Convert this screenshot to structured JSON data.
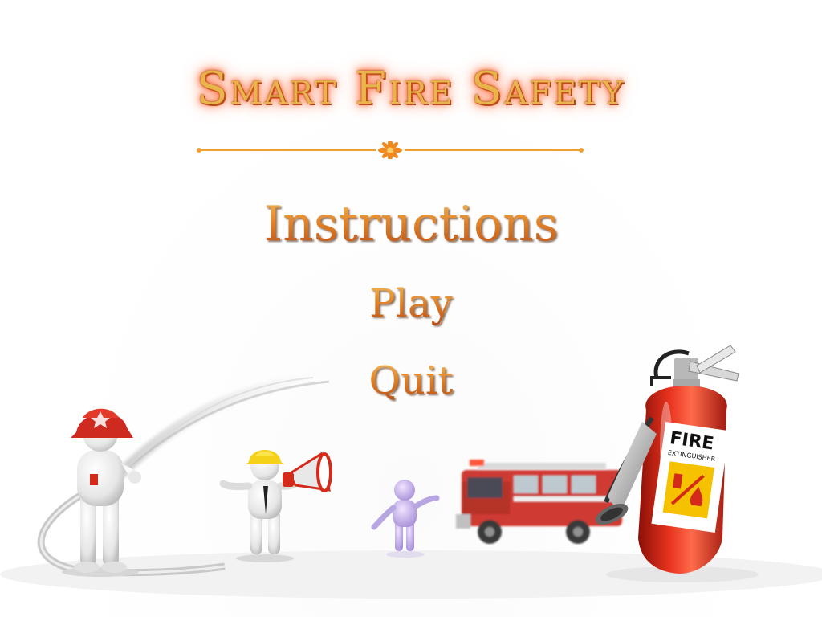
{
  "game": {
    "title": "Smart Fire Safety",
    "menu": [
      {
        "label": "Instructions"
      },
      {
        "label": "Play"
      },
      {
        "label": "Quit"
      }
    ]
  },
  "decor": {
    "extinguisher_label": "FIRE",
    "extinguisher_sublabel": "EXTINGUISHER"
  },
  "colors": {
    "menu_gold": "#e2852a",
    "title_glow": "#ff4a1a",
    "divider": "#f0a030",
    "extinguisher_red": "#d42a1a",
    "firetruck_red": "#cc2a22"
  }
}
